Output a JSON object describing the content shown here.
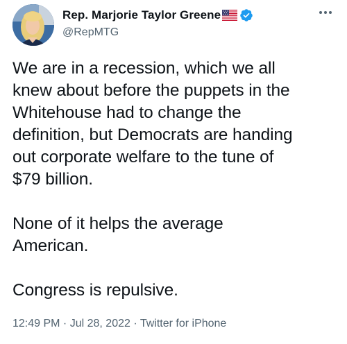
{
  "author": {
    "display_name": "Rep. Marjorie Taylor Greene",
    "handle": "@RepMTG",
    "avatar_icon": "profile-photo",
    "flag_icon": "us-flag-emoji",
    "verified_icon": "verified-badge-icon",
    "verified_color": "#1d9bf0"
  },
  "menu": {
    "icon": "more-options-icon"
  },
  "tweet": {
    "text": "We are in a recession, which we all\nknew about before the puppets in the\nWhitehouse had to change the\ndefinition, but Democrats are handing\nout corporate welfare to the tune of\n$79 billion.\n\nNone of it helps the average\nAmerican.\n\nCongress is repulsive."
  },
  "meta": {
    "time": "12:49 PM",
    "separator1": " · ",
    "date": "Jul 28, 2022",
    "separator2": " · ",
    "source": "Twitter for iPhone"
  },
  "colors": {
    "text_primary": "#0f1419",
    "text_secondary": "#536471",
    "accent": "#1d9bf0"
  }
}
